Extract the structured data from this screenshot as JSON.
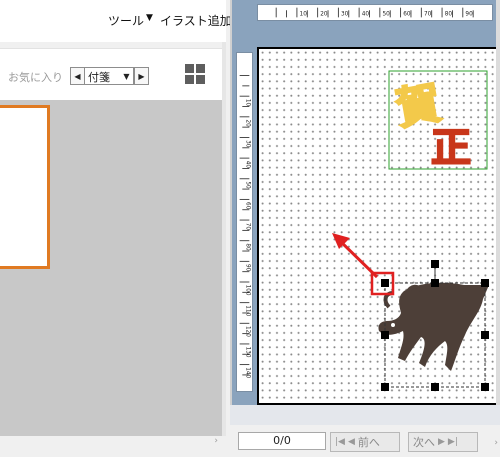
{
  "menubar": {
    "tools_label": "ツール",
    "illust_arrow": "▼",
    "illust_label": "イラスト追加"
  },
  "toolbar": {
    "favorites_label": "お気に入り",
    "tag_prev": "◀",
    "tag_value": "付箋",
    "tag_drop": "▼",
    "tag_next": "▶",
    "grid_icon": "grid-view-icon"
  },
  "rulers": {
    "horizontal_labels": [
      "10",
      "20",
      "30",
      "40",
      "50",
      "60",
      "70",
      "80",
      "90"
    ],
    "vertical_labels": [
      "10",
      "20",
      "30",
      "40",
      "50",
      "60",
      "70",
      "80",
      "90",
      "100",
      "110",
      "120",
      "130",
      "140"
    ]
  },
  "canvas": {
    "stamp_char_1": "賀",
    "stamp_char_2": "正",
    "stamp_frame_color": "#2ca02c",
    "arrow_color": "#e02020",
    "ox_color": "#4d3f38"
  },
  "footer": {
    "page_indicator": "0/0",
    "prev_label": "前へ",
    "next_label": "次へ"
  },
  "colors": {
    "thumb_border": "#e07a22",
    "pane_bg": "#8aa3bd",
    "content_bg": "#c8c8c8"
  }
}
